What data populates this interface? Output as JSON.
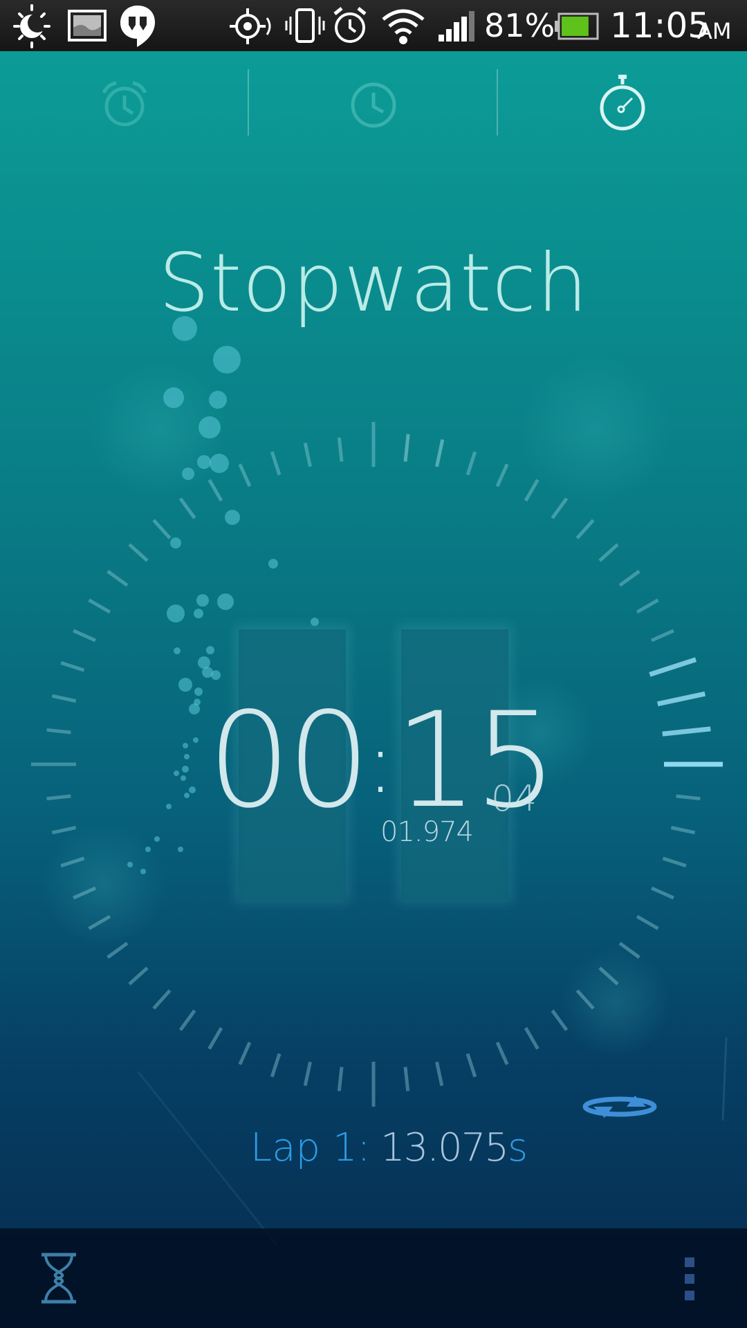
{
  "status_bar": {
    "battery_percent": "81%",
    "time": "11:05",
    "ampm": "AM",
    "icons": [
      "brightness-icon",
      "gallery-icon",
      "hangouts-icon",
      "gps-icon",
      "vibrate-icon",
      "alarm-clock-icon",
      "wifi-icon",
      "signal-icon",
      "battery-icon"
    ],
    "battery_level": 0.81
  },
  "tabs": [
    {
      "name": "alarm",
      "icon": "alarm-icon",
      "active": false
    },
    {
      "name": "world-clock",
      "icon": "clock-icon",
      "active": false
    },
    {
      "name": "stopwatch",
      "icon": "stopwatch-icon",
      "active": true
    }
  ],
  "title": "Stopwatch",
  "stopwatch": {
    "minutes": "00",
    "separator": ":",
    "seconds": "15",
    "hundredths": "04",
    "sub_time": "01.974"
  },
  "lap": {
    "label": "Lap 1:",
    "time_value": "13.075",
    "time_unit": "s"
  },
  "bottom_bar": {
    "left_icon": "hourglass-icon",
    "right_icon": "overflow-menu-icon"
  },
  "colors": {
    "accent_blue": "#2e9be3",
    "highlight_ticks": "#8fd8f0",
    "bottom_bar": "#030e20",
    "battery_fill": "#5ec21a"
  }
}
